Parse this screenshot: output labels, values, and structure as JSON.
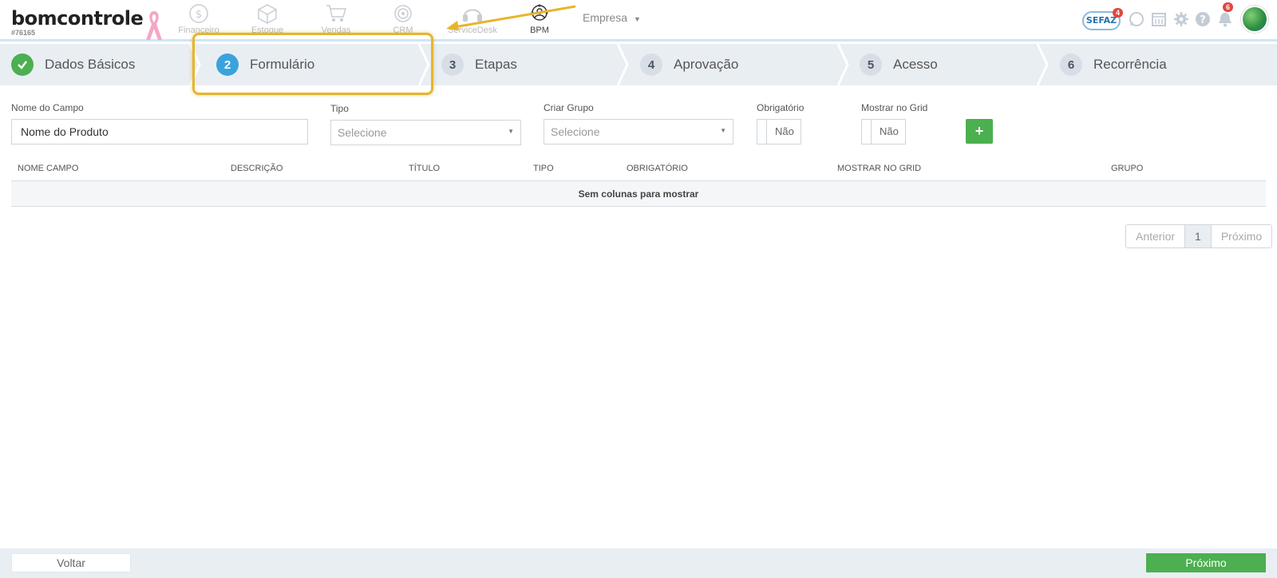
{
  "header": {
    "logo": "bomcontrole",
    "account_id": "#76165",
    "modules": [
      {
        "label": "Financeiro",
        "icon": "coin-icon"
      },
      {
        "label": "Estoque",
        "icon": "box-icon"
      },
      {
        "label": "Vendas",
        "icon": "cart-icon"
      },
      {
        "label": "CRM",
        "icon": "target-icon"
      },
      {
        "label": "ServiceDesk",
        "icon": "headset-icon"
      },
      {
        "label": "BPM",
        "icon": "bpm-icon"
      }
    ],
    "company": "Empresa",
    "sefaz_label": "SEFAZ",
    "sefaz_badge": "4",
    "notifications_badge": "6"
  },
  "wizard": {
    "steps": [
      {
        "num": "1",
        "label": "Dados Básicos",
        "state": "done"
      },
      {
        "num": "2",
        "label": "Formulário",
        "state": "current"
      },
      {
        "num": "3",
        "label": "Etapas",
        "state": "pending"
      },
      {
        "num": "4",
        "label": "Aprovação",
        "state": "pending"
      },
      {
        "num": "5",
        "label": "Acesso",
        "state": "pending"
      },
      {
        "num": "6",
        "label": "Recorrência",
        "state": "pending"
      }
    ]
  },
  "form": {
    "field_name_label": "Nome do Campo",
    "field_name_value": "Nome do Produto",
    "tipo_label": "Tipo",
    "tipo_value": "Selecione",
    "grupo_label": "Criar Grupo",
    "grupo_value": "Selecione",
    "obrigatorio_label": "Obrigatório",
    "obrigatorio_value": "Não",
    "grid_label": "Mostrar no Grid",
    "grid_value": "Não",
    "add_label": "+"
  },
  "table": {
    "columns": [
      "NOME CAMPO",
      "DESCRIÇÃO",
      "TÍTULO",
      "TIPO",
      "OBRIGATÓRIO",
      "MOSTRAR NO GRID",
      "GRUPO"
    ],
    "empty_message": "Sem colunas para mostrar"
  },
  "pagination": {
    "prev": "Anterior",
    "page": "1",
    "next": "Próximo"
  },
  "footer": {
    "back": "Voltar",
    "next": "Próximo"
  },
  "colors": {
    "accent_green": "#4caf50",
    "accent_blue": "#3aa3dc",
    "highlight": "#e7b52a"
  }
}
